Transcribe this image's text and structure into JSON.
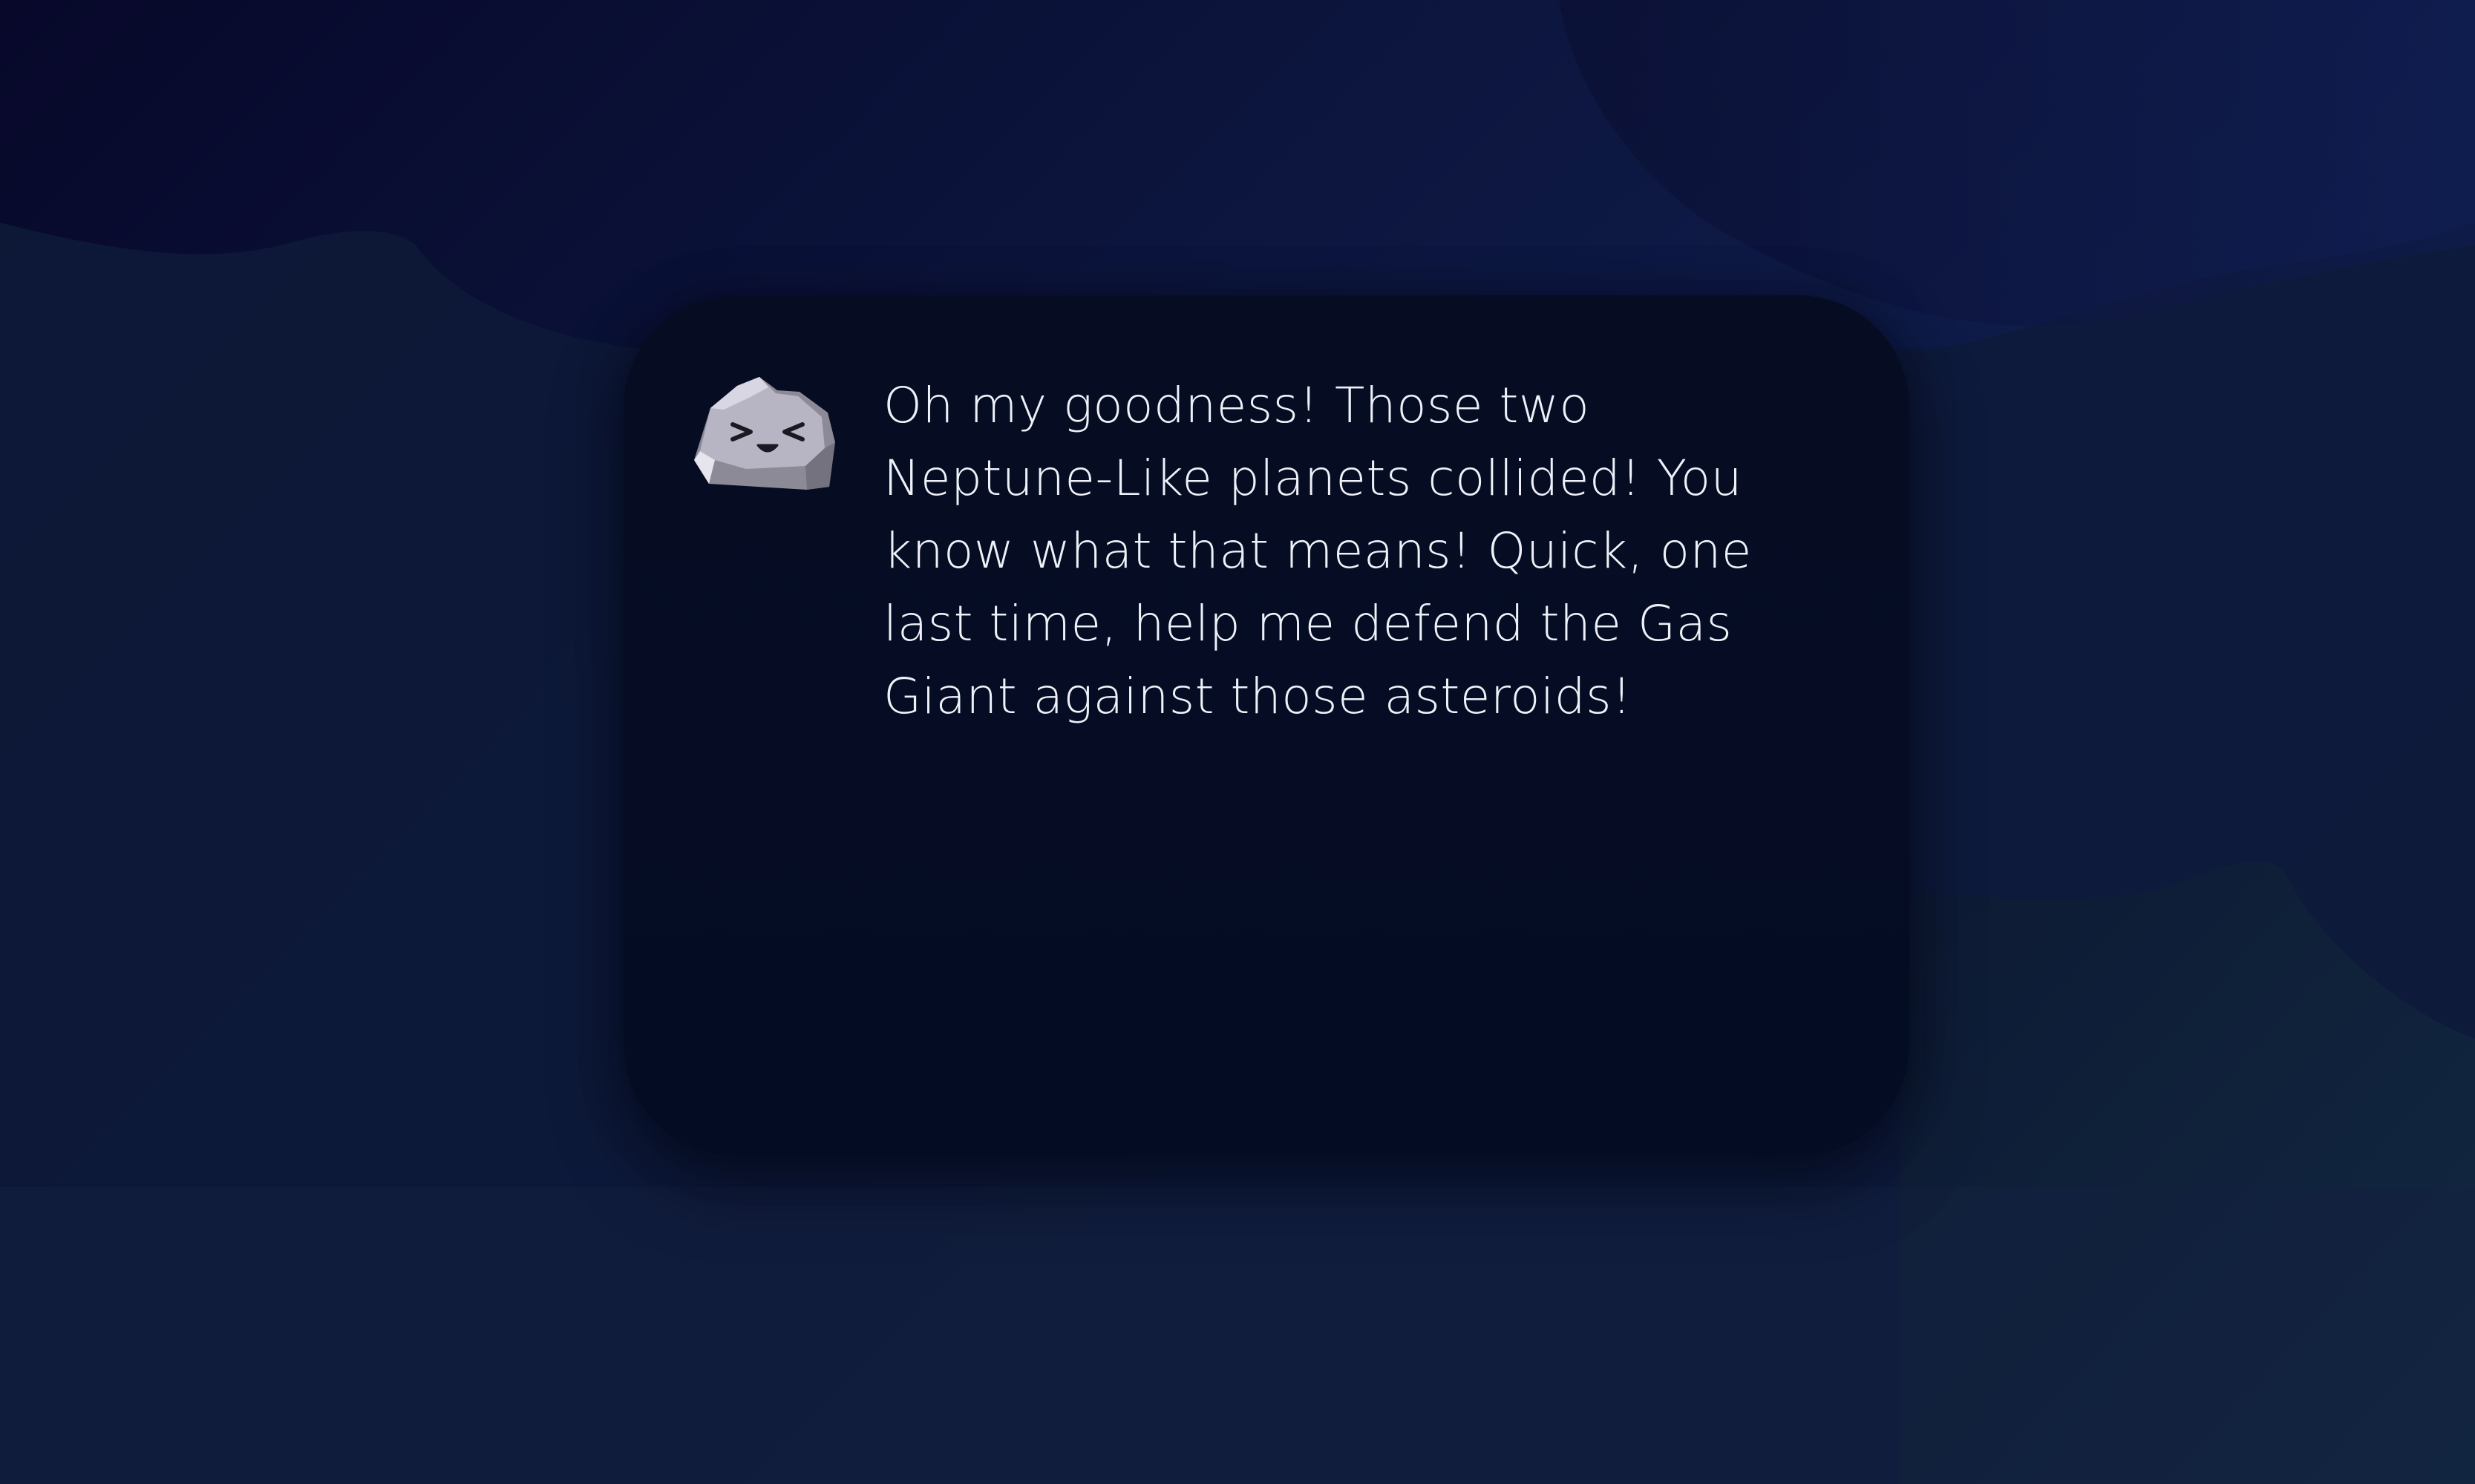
{
  "scene": {
    "background_colors": [
      "#07082a",
      "#0f1d4c",
      "#142a40"
    ]
  },
  "dialog": {
    "speaker_icon": "asteroid-character-icon",
    "speaker_expression": "excited (>_<) grin",
    "text": "Oh my goodness! Those two Neptune-Like planets collided! You know what that means! Quick, one last time, help me defend the Gas Giant against those asteroids!",
    "box_color": "#050c22",
    "text_color": "#eef1f8"
  }
}
